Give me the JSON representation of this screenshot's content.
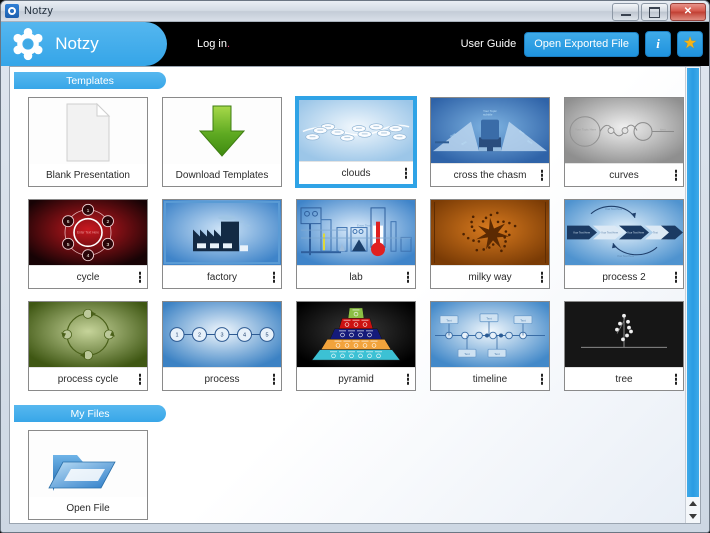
{
  "titlebar": {
    "title": "Notzy",
    "icon": "app-logo-icon",
    "minimize": "–",
    "maximize": "□",
    "close": "✕"
  },
  "header": {
    "brand": "Notzy",
    "login_label": "Log in",
    "login_dot": ".",
    "user_guide": "User Guide",
    "open_exported_file": "Open Exported File",
    "info_icon": "i",
    "star_icon": "★",
    "accent_color": "#35a5e8",
    "star_color": "#f5b316"
  },
  "sections": [
    {
      "title": "Templates"
    },
    {
      "title": "My Files"
    }
  ],
  "templates": [
    {
      "label": "Blank Presentation",
      "thumb": "blank-page",
      "selected": false,
      "has_menu": false
    },
    {
      "label": "Download Templates",
      "thumb": "download-arrow",
      "selected": false,
      "has_menu": false
    },
    {
      "label": "clouds",
      "thumb": "clouds",
      "selected": true,
      "has_menu": true
    },
    {
      "label": "cross the chasm",
      "thumb": "cross-the-chasm",
      "selected": false,
      "has_menu": true
    },
    {
      "label": "curves",
      "thumb": "curves",
      "selected": false,
      "has_menu": true
    },
    {
      "label": "cycle",
      "thumb": "cycle",
      "selected": false,
      "has_menu": true
    },
    {
      "label": "factory",
      "thumb": "factory",
      "selected": false,
      "has_menu": true
    },
    {
      "label": "lab",
      "thumb": "lab",
      "selected": false,
      "has_menu": true
    },
    {
      "label": "milky way",
      "thumb": "milky-way",
      "selected": false,
      "has_menu": true
    },
    {
      "label": "process 2",
      "thumb": "process-2",
      "selected": false,
      "has_menu": true
    },
    {
      "label": "process cycle",
      "thumb": "process-cycle",
      "selected": false,
      "has_menu": true
    },
    {
      "label": "process",
      "thumb": "process",
      "selected": false,
      "has_menu": true
    },
    {
      "label": "pyramid",
      "thumb": "pyramid",
      "selected": false,
      "has_menu": true
    },
    {
      "label": "timeline",
      "thumb": "timeline",
      "selected": false,
      "has_menu": true
    },
    {
      "label": "tree",
      "thumb": "tree",
      "selected": false,
      "has_menu": true
    }
  ],
  "myfiles": [
    {
      "label": "Open File",
      "thumb": "open-folder",
      "selected": false,
      "has_menu": false
    }
  ],
  "cycle_numbers": [
    "1",
    "2",
    "3",
    "4",
    "5",
    "6"
  ],
  "process_numbers": [
    "1",
    "2",
    "3",
    "4",
    "5"
  ],
  "scrollbar": {
    "up_arrow": "▲",
    "down_arrow": "▼"
  }
}
